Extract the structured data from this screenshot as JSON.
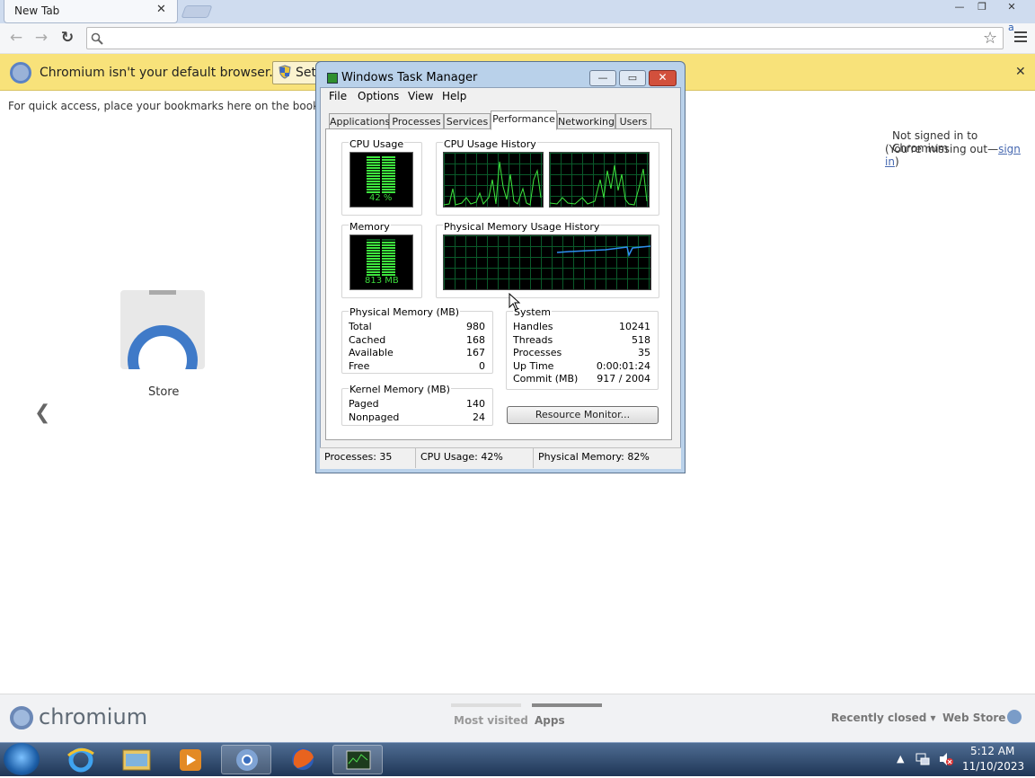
{
  "browser": {
    "tab_title": "New Tab",
    "tab_close": "✕",
    "window_controls": {
      "minimize": "—",
      "restore": "❐",
      "close": "✕"
    },
    "nav": {
      "back": "←",
      "forward": "→",
      "reload": "↻"
    },
    "omnibox_placeholder": "",
    "infobar": {
      "message": "Chromium isn't your default browser.",
      "button_label": "Set",
      "close": "✕"
    },
    "bookmarks_hint": "For quick access, place your bookmarks here on the bookmarks b",
    "signin": {
      "line1": "Not signed in to Chromium",
      "line2_prefix": "(You're missing out—",
      "link": "sign in",
      "line2_suffix": ")"
    },
    "app": {
      "label": "Store"
    },
    "prev_arrow": "❮",
    "footer": {
      "brand": "chromium",
      "most_visited": "Most visited",
      "apps": "Apps",
      "recently_closed": "Recently closed ▾",
      "web_store": "Web Store"
    }
  },
  "task_manager": {
    "title": "Windows Task Manager",
    "menu": [
      "File",
      "Options",
      "View",
      "Help"
    ],
    "tabs": [
      "Applications",
      "Processes",
      "Services",
      "Performance",
      "Networking",
      "Users"
    ],
    "selected_tab": "Performance",
    "cpu_usage": {
      "label": "CPU Usage",
      "value": "42 %"
    },
    "cpu_history_label": "CPU Usage History",
    "memory": {
      "label": "Memory",
      "value": "813 MB"
    },
    "phys_mem_history_label": "Physical Memory Usage History",
    "physical_memory": {
      "label": "Physical Memory (MB)",
      "rows": [
        [
          "Total",
          "980"
        ],
        [
          "Cached",
          "168"
        ],
        [
          "Available",
          "167"
        ],
        [
          "Free",
          "0"
        ]
      ]
    },
    "kernel_memory": {
      "label": "Kernel Memory (MB)",
      "rows": [
        [
          "Paged",
          "140"
        ],
        [
          "Nonpaged",
          "24"
        ]
      ]
    },
    "system": {
      "label": "System",
      "rows": [
        [
          "Handles",
          "10241"
        ],
        [
          "Threads",
          "518"
        ],
        [
          "Processes",
          "35"
        ],
        [
          "Up Time",
          "0:00:01:24"
        ],
        [
          "Commit (MB)",
          "917 / 2004"
        ]
      ]
    },
    "resource_monitor": "Resource Monitor...",
    "status": {
      "processes": "Processes: 35",
      "cpu": "CPU Usage: 42%",
      "memory": "Physical Memory: 82%"
    }
  },
  "taskbar": {
    "time": "5:12 AM",
    "date": "11/10/2023",
    "tray_arrow": "▲"
  }
}
